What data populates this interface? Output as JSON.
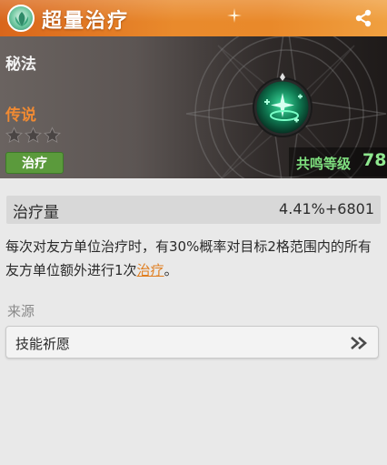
{
  "header": {
    "title": "超量治疗",
    "title_icon": "heal-skill-icon",
    "share_icon": "share-icon"
  },
  "hero": {
    "category": "秘法",
    "rarity": "传说",
    "stars_filled": 0,
    "stars_total": 3,
    "tag": "治疗",
    "level_label": "共鸣等级",
    "level_value": "78",
    "orb_icon": "green-heal-orb-icon"
  },
  "stat": {
    "label": "治疗量",
    "value": "4.41%+6801"
  },
  "description": {
    "text_before": "每次对友方单位治疗时，有30%概率对目标2格范围内的所有友方单位额外进行1次",
    "link_text": "治疗",
    "text_after": "。"
  },
  "source": {
    "title": "来源",
    "item_label": "技能祈愿"
  },
  "colors": {
    "header_orange": "#e98a2c",
    "rarity_orange": "#f08a33",
    "tag_green": "#5b9a3c",
    "level_green": "#8fe88f",
    "link_orange": "#e07d1e"
  }
}
